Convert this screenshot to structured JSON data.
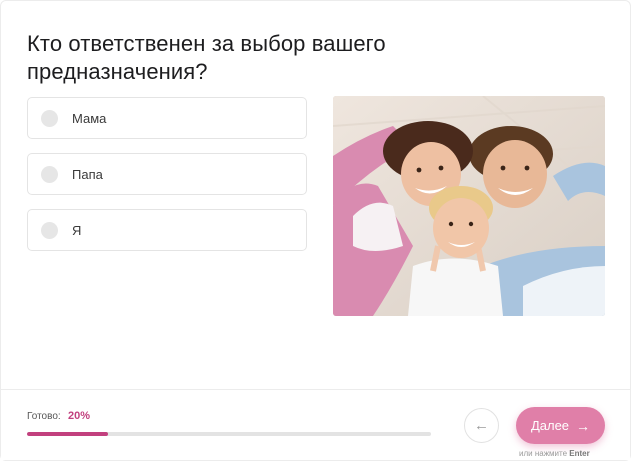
{
  "question": {
    "title": "Кто ответственен за выбор вашего предназначения?"
  },
  "options": [
    {
      "label": "Мама"
    },
    {
      "label": "Папа"
    },
    {
      "label": "Я"
    }
  ],
  "image": {
    "subject": "smiling family lying on floor"
  },
  "progress": {
    "label": "Готово:",
    "value_text": "20%",
    "fraction": 0.2,
    "accent_color": "#c2407e"
  },
  "navigation": {
    "back_icon": "arrow-left-icon",
    "next_label": "Далее",
    "next_icon": "arrow-right-icon",
    "next_color": "#e07fa8",
    "hint_prefix": "или нажмите",
    "hint_key": "Enter"
  }
}
